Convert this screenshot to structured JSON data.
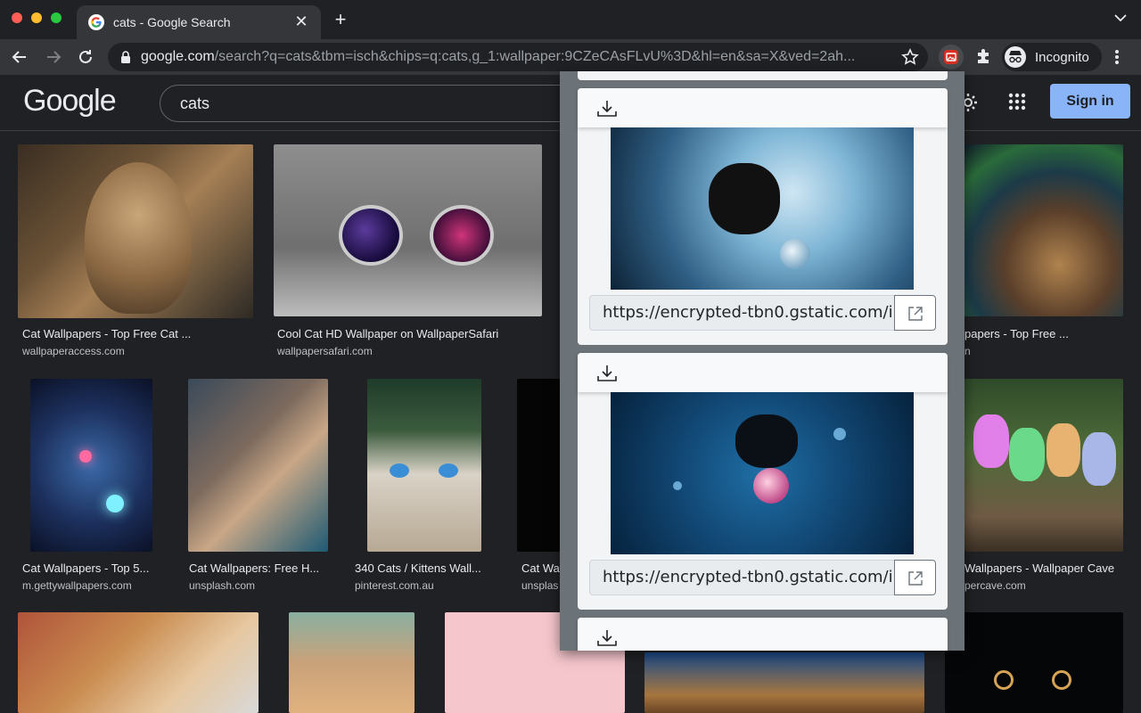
{
  "browser": {
    "tab_title": "cats - Google Search",
    "url_host": "google.com",
    "url_path": "/search?q=cats&tbm=isch&chips=q:cats,g_1:wallpaper:9CZeCAsFLvU%3D&hl=en&sa=X&ved=2ah...",
    "profile_label": "Incognito"
  },
  "google": {
    "logo": "Google",
    "query": "cats",
    "sign_in": "Sign in"
  },
  "results": [
    {
      "title": "Cat Wallpapers - Top Free Cat ...",
      "source": "wallpaperaccess.com"
    },
    {
      "title": "Cool Cat HD Wallpaper on WallpaperSafari",
      "source": "wallpapersafari.com"
    },
    {
      "title": "papers - Top Free ...",
      "source": "n"
    },
    {
      "title": "Cat Wallpapers - Top 5...",
      "source": "m.gettywallpapers.com"
    },
    {
      "title": "Cat Wallpapers: Free H...",
      "source": "unsplash.com"
    },
    {
      "title": "340 Cats / Kittens Wall...",
      "source": "pinterest.com.au"
    },
    {
      "title": "Cat Wa",
      "source": "unsplas"
    },
    {
      "title": "Wallpapers - Wallpaper Cave",
      "source": "percave.com"
    }
  ],
  "popup": {
    "cards": [
      {
        "url": "https://encrypted-tbn0.gstatic.com/images?q=tbn"
      },
      {
        "url": "https://encrypted-tbn0.gstatic.com/images?q=tbn"
      }
    ]
  },
  "colors": {
    "page_bg": "#202124",
    "signin_bg": "#8ab4f8",
    "popup_bg": "#6b7379",
    "card_bg": "#f3f4f6"
  }
}
